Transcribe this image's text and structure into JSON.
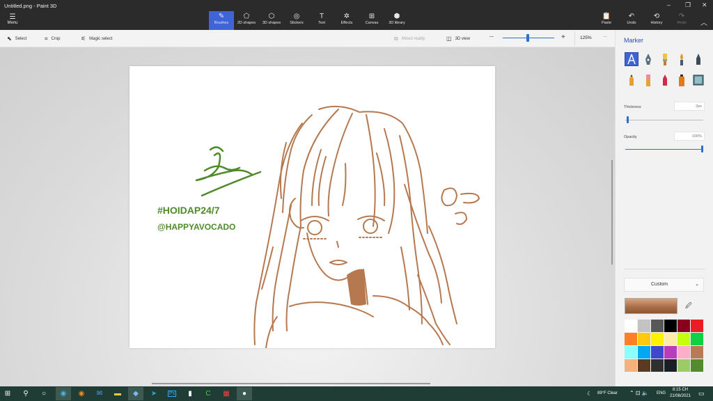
{
  "window": {
    "title": "Untitled.png - Paint 3D",
    "minimize": "–",
    "restore": "❐",
    "close": "✕"
  },
  "ribbon": {
    "menu": {
      "label": "Menu",
      "icon": "☰"
    },
    "tools": [
      {
        "label": "Brushes",
        "icon": "✎",
        "active": true
      },
      {
        "label": "2D shapes",
        "icon": "⬠"
      },
      {
        "label": "3D shapes",
        "icon": "⬡"
      },
      {
        "label": "Stickers",
        "icon": "◎"
      },
      {
        "label": "Text",
        "icon": "T"
      },
      {
        "label": "Effects",
        "icon": "✲"
      },
      {
        "label": "Canvas",
        "icon": "⊞"
      },
      {
        "label": "3D library",
        "icon": "⬢"
      }
    ],
    "right": [
      {
        "label": "Paste",
        "icon": "📋"
      },
      {
        "label": "Undo",
        "icon": "↶"
      },
      {
        "label": "History",
        "icon": "⟲"
      },
      {
        "label": "Redo",
        "icon": "↷",
        "disabled": true
      }
    ],
    "collapse": "︿"
  },
  "commandbar": {
    "select": "Select",
    "crop": "Crop",
    "magic_select": "Magic select",
    "mixed_reality": "Mixed reality",
    "view3d": "3D view",
    "zoom_out": "—",
    "zoom_in": "+",
    "zoom": "125%",
    "more": "···"
  },
  "panel": {
    "title": "Marker",
    "thickness_label": "Thickness",
    "thickness_value": "2px",
    "opacity_label": "Opacity",
    "opacity_value": "100%",
    "thickness_fraction": 0.02,
    "opacity_fraction": 1.0,
    "custom_label": "Custom",
    "custom_chevron": "⌄",
    "picker_icon": "🖉",
    "current_color": "#a86b47",
    "palette": [
      "#ffffff",
      "#c3c3c3",
      "#585858",
      "#000000",
      "#88001b",
      "#ec1c24",
      "#ff7f27",
      "#ffc90e",
      "#fff200",
      "#fdeca6",
      "#c4ff0e",
      "#0ed145",
      "#8cfffb",
      "#00a8f3",
      "#3f48cc",
      "#b83dba",
      "#ffaec8",
      "#b97a56",
      "#f6b17a",
      "#5a3a22",
      "#2f2f2f",
      "#1a1f26",
      "#9ccc65",
      "#558b2f"
    ]
  },
  "canvas_text": {
    "hashtag": "#HOIDAP24/7",
    "handle": "@HAPPYAVOCADO"
  },
  "taskbar": {
    "weather": "89°F Clear",
    "lang": "ENG",
    "time": "8:15 CH",
    "date": "21/08/2021",
    "icons": [
      "windows-icon",
      "search-icon",
      "cortana-icon",
      "edge-icon",
      "firefox-icon",
      "mail-icon",
      "explorer-icon",
      "paint3d-icon",
      "telegram-icon",
      "photoshop-icon",
      "notepad-icon",
      "camtasia-icon",
      "gallery-icon",
      "zalo-icon"
    ]
  }
}
